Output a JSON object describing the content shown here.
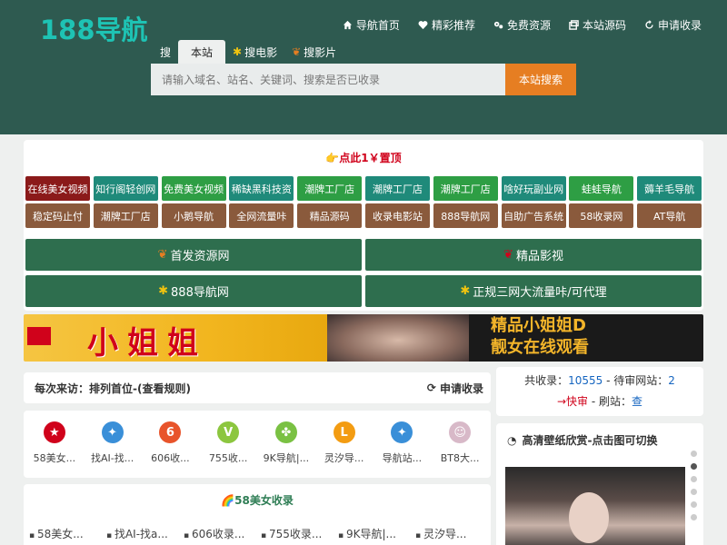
{
  "header": {
    "logo": "188导航",
    "nav": [
      {
        "label": "导航首页",
        "icon": "home-icon"
      },
      {
        "label": "精彩推荐",
        "icon": "heart-icon"
      },
      {
        "label": "免费资源",
        "icon": "gears-icon"
      },
      {
        "label": "本站源码",
        "icon": "window-icon"
      },
      {
        "label": "申请收录",
        "icon": "refresh-icon"
      }
    ]
  },
  "search": {
    "tabs": [
      "搜",
      "本站",
      "搜电影",
      "搜影片"
    ],
    "placeholder": "请输入域名、站名、关键词、搜索是否已收录",
    "button": "本站搜索"
  },
  "promo": "点此1￥置顶",
  "grid_row1": [
    {
      "label": "在线美女视频",
      "color": "#8b1a1a"
    },
    {
      "label": "知行阁轻创网",
      "color": "#1f8a7a"
    },
    {
      "label": "免费美女视频",
      "color": "#2e9e44"
    },
    {
      "label": "稀缺黑科技资",
      "color": "#1f8a7a"
    },
    {
      "label": "潮牌工厂店",
      "color": "#2e9e44"
    },
    {
      "label": "潮牌工厂店",
      "color": "#1f8a7a"
    },
    {
      "label": "潮牌工厂店",
      "color": "#2e9e44"
    },
    {
      "label": "啥好玩副业网",
      "color": "#1f8a7a"
    },
    {
      "label": "蛙蛙导航",
      "color": "#2e9e44"
    },
    {
      "label": "薅羊毛导航",
      "color": "#1f8a7a"
    }
  ],
  "grid_row2": [
    {
      "label": "稳定码止付",
      "color": "#8a5a3c"
    },
    {
      "label": "潮牌工厂店",
      "color": "#8a5a3c"
    },
    {
      "label": "小鹅导航",
      "color": "#8a5a3c"
    },
    {
      "label": "全网流量咔",
      "color": "#8a5a3c"
    },
    {
      "label": "精品源码",
      "color": "#8a5a3c"
    },
    {
      "label": "收录电影站",
      "color": "#8a5a3c"
    },
    {
      "label": "888导航网",
      "color": "#8a5a3c"
    },
    {
      "label": "自助广告系统",
      "color": "#8a5a3c"
    },
    {
      "label": "58收录网",
      "color": "#8a5a3c"
    },
    {
      "label": "AT导航",
      "color": "#8a5a3c"
    }
  ],
  "big_buttons": [
    {
      "label": "首发资源网",
      "icon": "maple-leaf-icon"
    },
    {
      "label": "精品影视",
      "icon": "maple-leaf-icon"
    },
    {
      "label": "888导航网",
      "icon": "flower-icon"
    },
    {
      "label": "正规三网大流量咔/可代理",
      "icon": "flower-icon"
    }
  ],
  "banner": {
    "left_text": "小姐姐",
    "right_line1": "精品小姐姐D",
    "right_line2": "靓女在线观看"
  },
  "visit": {
    "text": "每次来访：排列首位-(查看规则)",
    "apply": "申请收录"
  },
  "sites": [
    {
      "name": "58美女...",
      "icon": "star-icon",
      "color": "#d0021b",
      "glyph": "★"
    },
    {
      "name": "找AI-找...",
      "icon": "pinwheel-icon",
      "color": "#3a8fd8",
      "glyph": "✦"
    },
    {
      "name": "606收...",
      "icon": "six-icon",
      "color": "#e8542b",
      "glyph": "6"
    },
    {
      "name": "755收...",
      "icon": "v-logo-icon",
      "color": "#8cc63f",
      "glyph": "V"
    },
    {
      "name": "9K导航|...",
      "icon": "clover-icon",
      "color": "#7ac143",
      "glyph": "✤"
    },
    {
      "name": "灵汐导...",
      "icon": "l-logo-icon",
      "color": "#f39c12",
      "glyph": "L"
    },
    {
      "name": "导航站...",
      "icon": "pinwheel-icon",
      "color": "#3a8fd8",
      "glyph": "✦"
    },
    {
      "name": "BT8大...",
      "icon": "avatar-icon",
      "color": "#d8b9c8",
      "glyph": "☺"
    }
  ],
  "list": {
    "title": "58美女收录",
    "items": [
      "58美女...",
      "找AI-找a...",
      "606收录...",
      "755收录...",
      "9K导航|...",
      "灵汐导..."
    ]
  },
  "stats": {
    "total_label": "共收录：",
    "total": "10555",
    "pending_label": " - 待审网站：",
    "pending": "2",
    "fast_label": "→快审",
    "sep": " - 刷站：",
    "check": "查"
  },
  "wallpaper": {
    "title": "高清壁纸欣赏-点击图可切换"
  }
}
